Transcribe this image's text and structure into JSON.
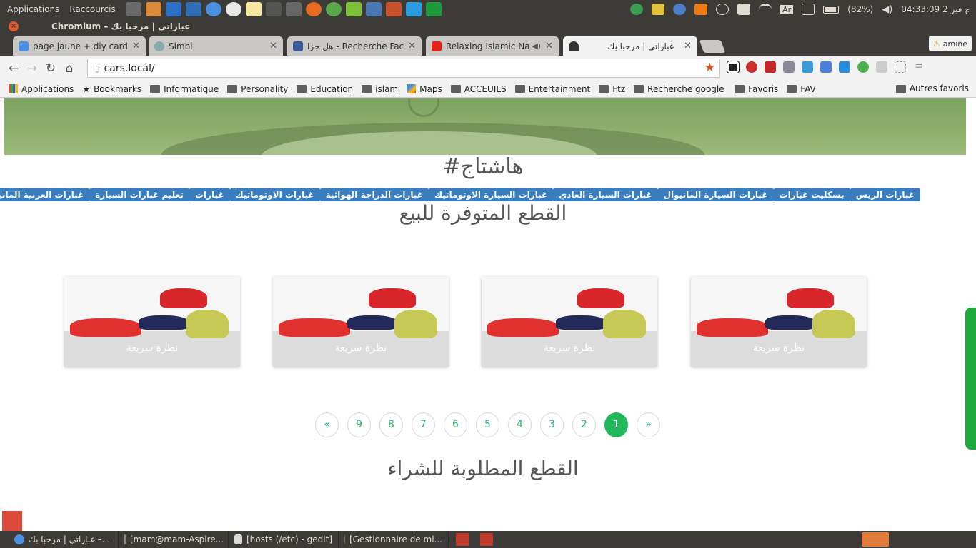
{
  "system_panel": {
    "menu_items": [
      "Applications",
      "Raccourcis"
    ],
    "keyboard": "Ar",
    "battery": "(82%)",
    "clock": "04:33:09 2 ج فبر"
  },
  "window": {
    "title": "Chromium – غباراتي | مرحبا بك"
  },
  "tabs": [
    {
      "label": "page jaune + diy card v + w"
    },
    {
      "label": "Simbi"
    },
    {
      "label": "هل جزا - Recherche Facebook"
    },
    {
      "label": "Relaxing Islamic Nashe"
    },
    {
      "label": "غباراتي | مرحبا بك"
    }
  ],
  "profile": {
    "name": "amine"
  },
  "address_bar": {
    "url": "cars.local/"
  },
  "bookmarks": [
    "Applications",
    "Bookmarks",
    "Informatique",
    "Personality",
    "Education",
    "islam",
    "Maps",
    "ACCEUILS",
    "Entertainment",
    "Ftz",
    "Recherche google a tr",
    "Favoris",
    "FAV"
  ],
  "bookmarks_right": "Autres favoris",
  "page": {
    "hashtag_title": "#هاشتاج",
    "tags": [
      "غبارات الريس",
      "بسكليت غبارات",
      "غبارات السيارة المانيوال",
      "غبارات السيارة العادي",
      "غبارات السيارة الاوتوماتيك",
      "غبارات الدراجة الهوائية",
      "غبارات الاوتوماتيك",
      "غبارات",
      "تعليم غبارات السيارة",
      "غبارات العربية المانيوال"
    ],
    "available_title": "القطع المتوفرة للبيع",
    "products": [
      {
        "quick_view": "نظرة سريعة"
      },
      {
        "quick_view": "نظرة سريعة"
      },
      {
        "quick_view": "نظرة سريعة"
      },
      {
        "quick_view": "نظرة سريعة"
      }
    ],
    "pagination": [
      "»",
      "1",
      "2",
      "3",
      "4",
      "5",
      "6",
      "7",
      "8",
      "9",
      "«"
    ],
    "active_page": "1",
    "wanted_title": "القطع المطلوبة للشراء"
  },
  "taskbar": [
    {
      "label": "غباراتي | مرحبا بك –..."
    },
    {
      "label": "[mam@mam-Aspire..."
    },
    {
      "label": "[hosts (/etc) - gedit]"
    },
    {
      "label": "[Gestionnaire de mi..."
    }
  ],
  "colors": {
    "tag_blue": "#3a7ec0",
    "active_page": "#21b75b",
    "page_link": "#2bb673",
    "scroll_thumb": "#1fa83e"
  }
}
